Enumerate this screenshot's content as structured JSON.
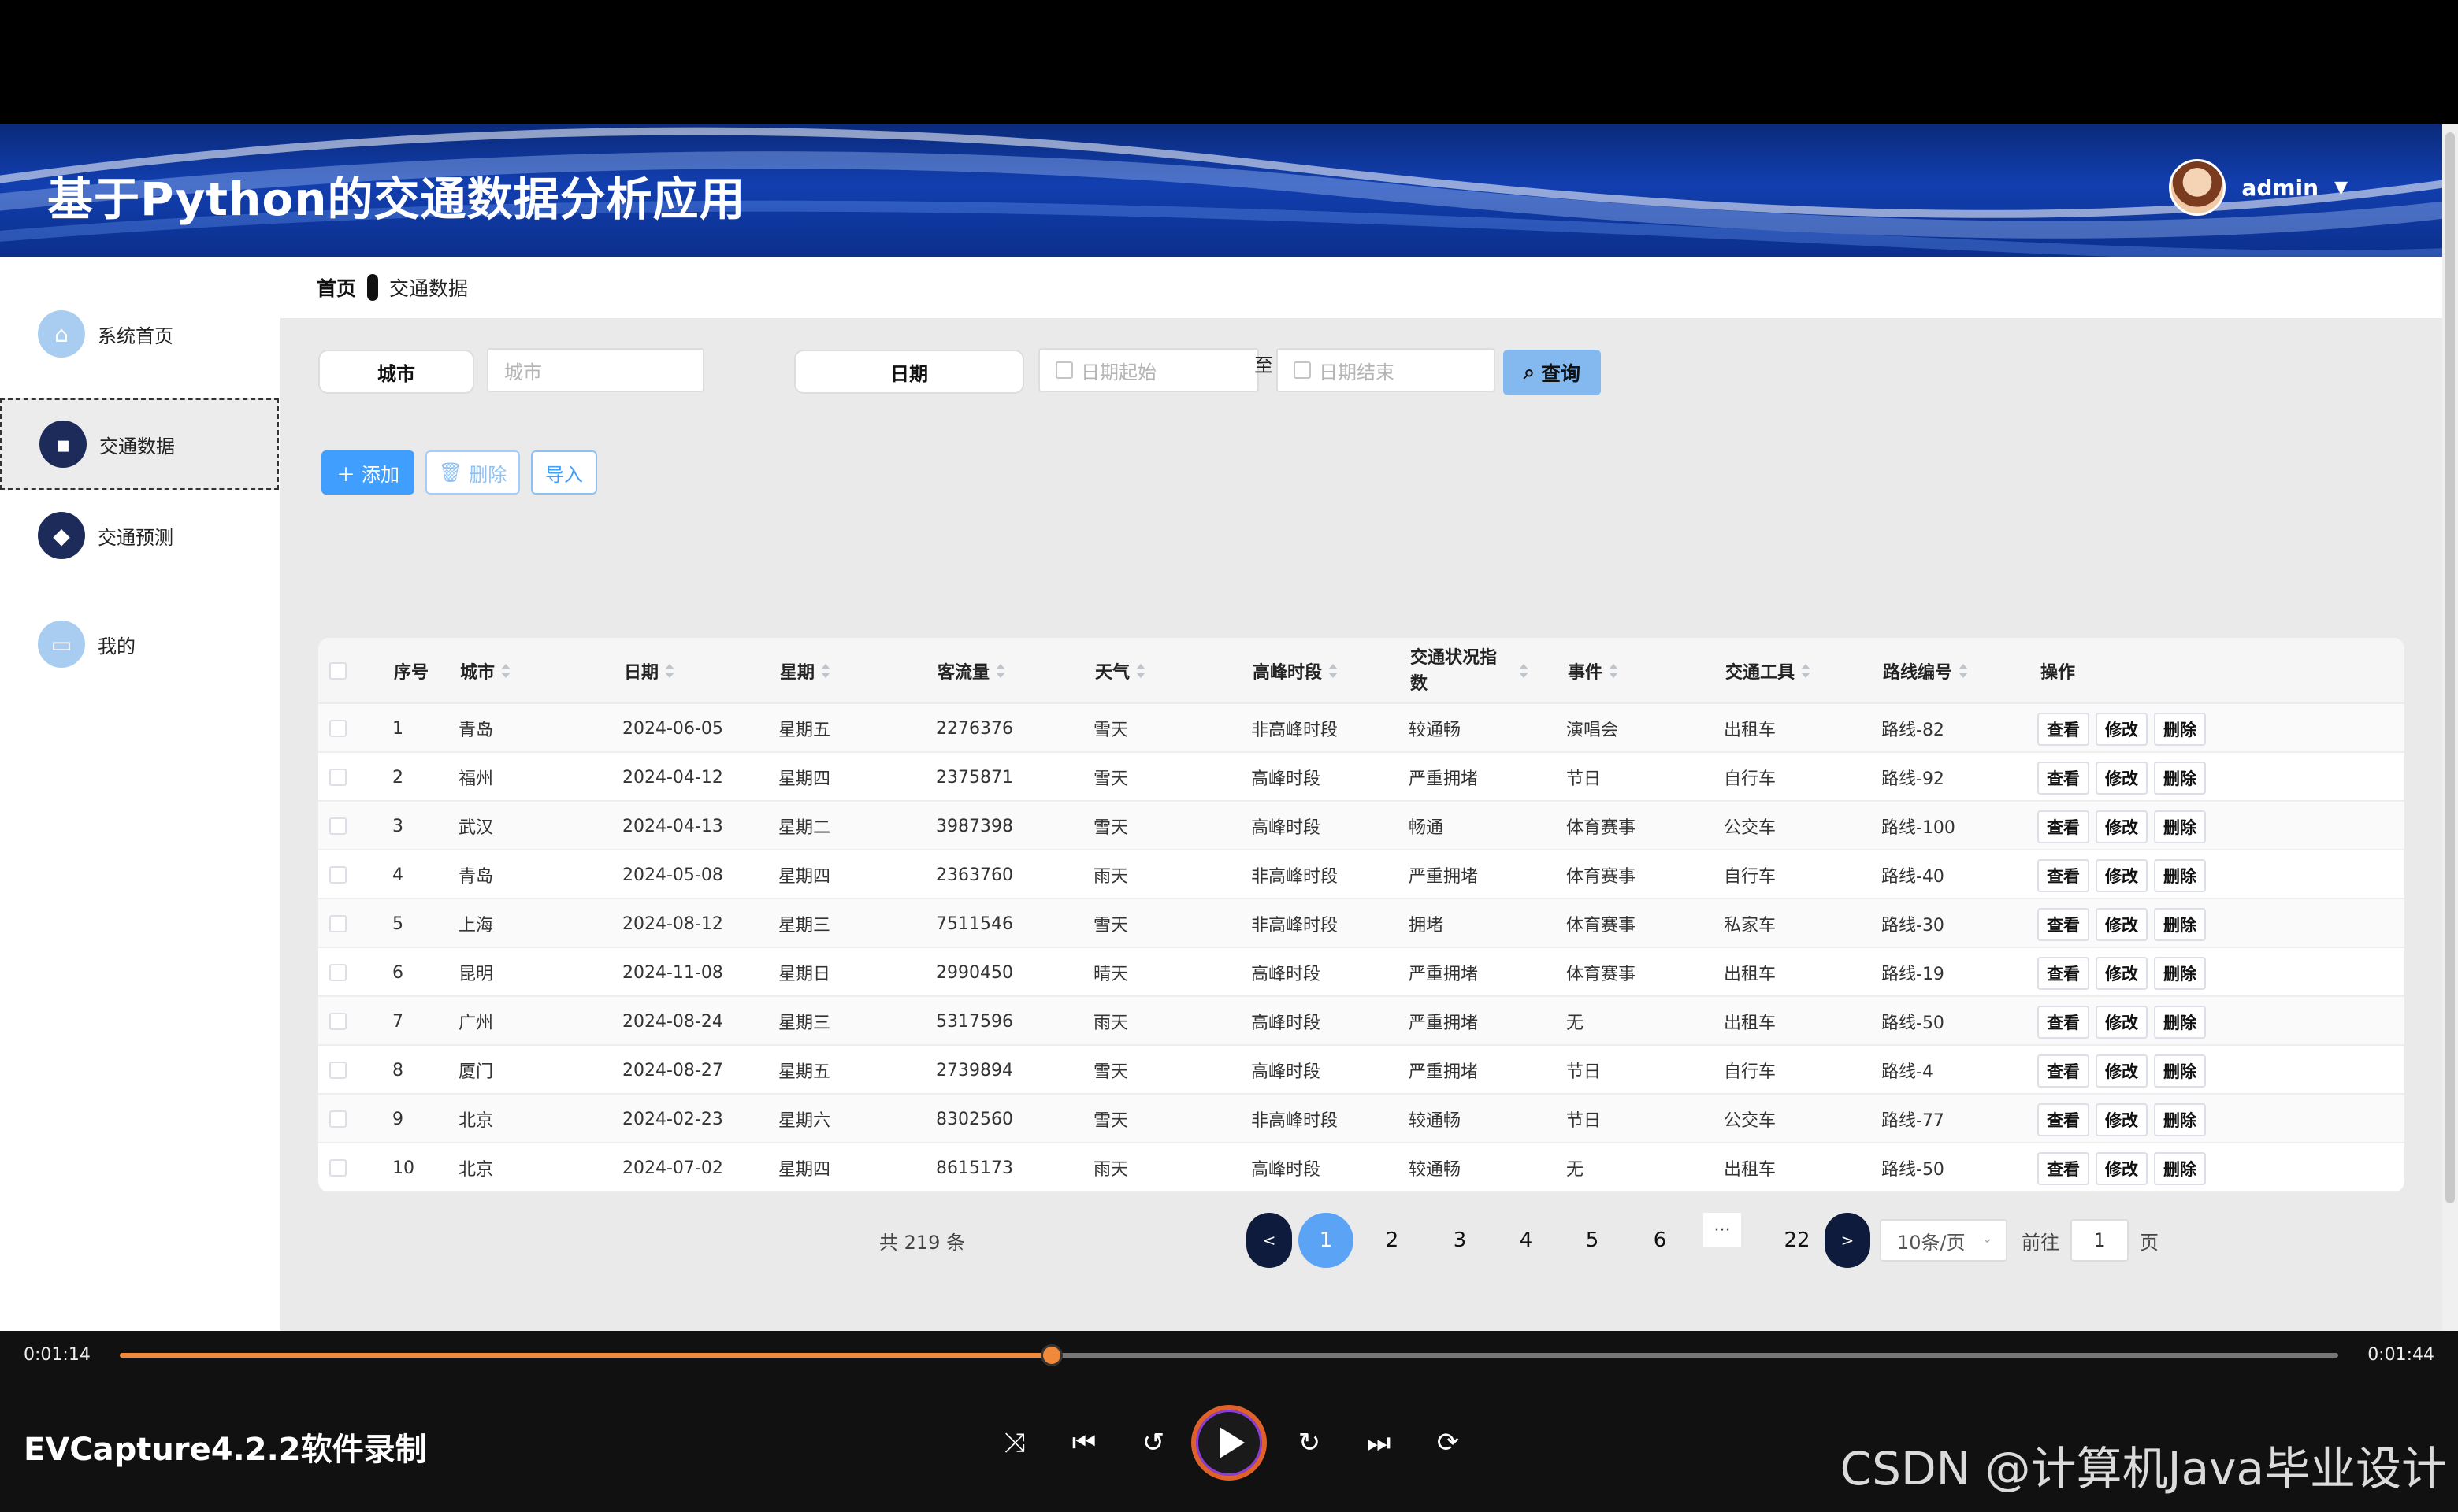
{
  "app": {
    "title": "基于Python的交通数据分析应用",
    "user": "admin"
  },
  "sidebar": {
    "items": [
      {
        "label": "系统首页",
        "icon": "home-icon"
      },
      {
        "label": "交通数据",
        "icon": "chat-icon"
      },
      {
        "label": "交通预测",
        "icon": "chart-icon"
      },
      {
        "label": "我的",
        "icon": "profile-icon"
      }
    ]
  },
  "breadcrumb": {
    "home": "首页",
    "current": "交通数据"
  },
  "filters": {
    "city_label": "城市",
    "city_placeholder": "城市",
    "date_label": "日期",
    "date_start_placeholder": "日期起始",
    "date_to": "至",
    "date_end_placeholder": "日期结束",
    "query": "查询"
  },
  "toolbar": {
    "add": "添加",
    "delete": "删除",
    "import": "导入"
  },
  "table": {
    "columns": [
      "序号",
      "城市",
      "日期",
      "星期",
      "客流量",
      "天气",
      "高峰时段",
      "交通状况指数",
      "事件",
      "交通工具",
      "路线编号",
      "操作"
    ],
    "ops": {
      "view": "查看",
      "edit": "修改",
      "delete": "删除"
    },
    "rows": [
      [
        "1",
        "青岛",
        "2024-06-05",
        "星期五",
        "2276376",
        "雪天",
        "非高峰时段",
        "较通畅",
        "演唱会",
        "出租车",
        "路线-82"
      ],
      [
        "2",
        "福州",
        "2024-04-12",
        "星期四",
        "2375871",
        "雪天",
        "高峰时段",
        "严重拥堵",
        "节日",
        "自行车",
        "路线-92"
      ],
      [
        "3",
        "武汉",
        "2024-04-13",
        "星期二",
        "3987398",
        "雪天",
        "高峰时段",
        "畅通",
        "体育赛事",
        "公交车",
        "路线-100"
      ],
      [
        "4",
        "青岛",
        "2024-05-08",
        "星期四",
        "2363760",
        "雨天",
        "非高峰时段",
        "严重拥堵",
        "体育赛事",
        "自行车",
        "路线-40"
      ],
      [
        "5",
        "上海",
        "2024-08-12",
        "星期三",
        "7511546",
        "雪天",
        "非高峰时段",
        "拥堵",
        "体育赛事",
        "私家车",
        "路线-30"
      ],
      [
        "6",
        "昆明",
        "2024-11-08",
        "星期日",
        "2990450",
        "晴天",
        "高峰时段",
        "严重拥堵",
        "体育赛事",
        "出租车",
        "路线-19"
      ],
      [
        "7",
        "广州",
        "2024-08-24",
        "星期三",
        "5317596",
        "雨天",
        "高峰时段",
        "严重拥堵",
        "无",
        "出租车",
        "路线-50"
      ],
      [
        "8",
        "厦门",
        "2024-08-27",
        "星期五",
        "2739894",
        "雪天",
        "高峰时段",
        "严重拥堵",
        "节日",
        "自行车",
        "路线-4"
      ],
      [
        "9",
        "北京",
        "2024-02-23",
        "星期六",
        "8302560",
        "雪天",
        "非高峰时段",
        "较通畅",
        "节日",
        "公交车",
        "路线-77"
      ],
      [
        "10",
        "北京",
        "2024-07-02",
        "星期四",
        "8615173",
        "雨天",
        "高峰时段",
        "较通畅",
        "无",
        "出租车",
        "路线-50"
      ]
    ]
  },
  "pagination": {
    "total": "共 219 条",
    "prev": "<",
    "next": ">",
    "pages": [
      "1",
      "2",
      "3",
      "4",
      "5",
      "6"
    ],
    "more": "···",
    "last": "22",
    "current": "1",
    "page_size": "10条/页",
    "goto_label": "前往",
    "goto_value": "1",
    "goto_unit": "页"
  },
  "player": {
    "current_time": "0:01:14",
    "total_time": "0:01:44",
    "progress": 0.42,
    "recorder": "EVCapture4.2.2软件录制",
    "watermark": "CSDN @计算机Java毕业设计"
  }
}
